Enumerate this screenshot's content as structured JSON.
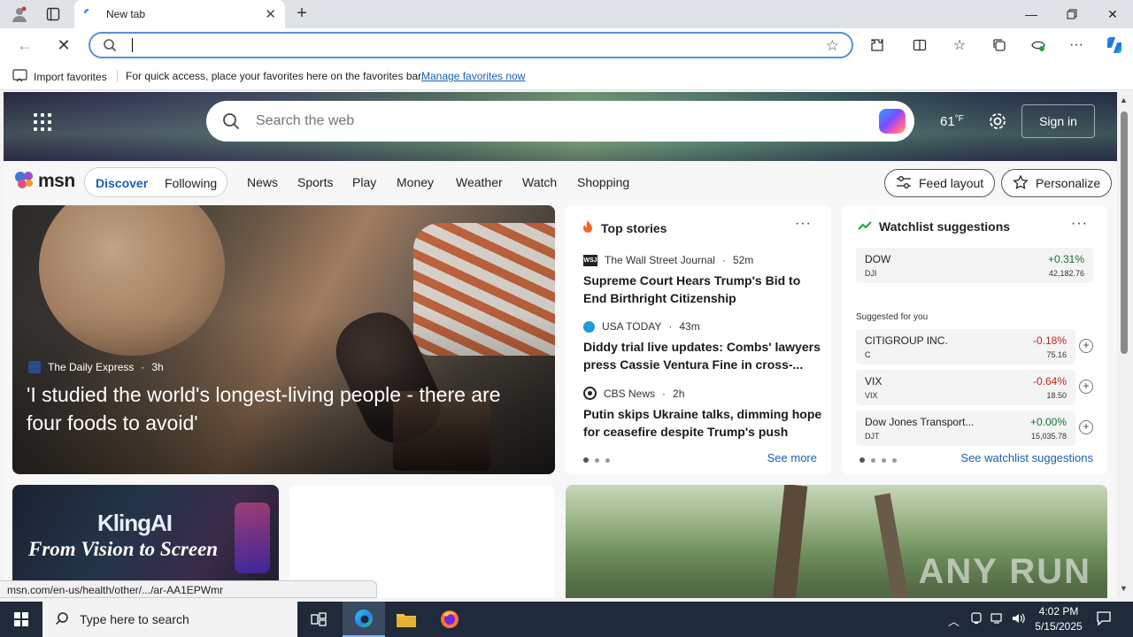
{
  "browser": {
    "tab_title": "New tab",
    "address_value": "",
    "favbar": {
      "import_label": "Import favorites",
      "message": "For quick access, place your favorites here on the favorites bar.",
      "manage_link": "Manage favorites now"
    }
  },
  "msn": {
    "search_placeholder": "Search the web",
    "weather_temp": "61",
    "weather_unit": "°F",
    "signin_label": "Sign in",
    "logo_text": "msn",
    "feed_tabs": [
      "Discover",
      "Following"
    ],
    "nav_links": [
      "News",
      "Sports",
      "Play",
      "Money",
      "Weather",
      "Watch",
      "Shopping"
    ],
    "feed_layout_label": "Feed layout",
    "personalize_label": "Personalize"
  },
  "hero": {
    "source": "The Daily Express",
    "age": "3h",
    "title": "'I studied the world's longest-living people - there are four foods to avoid'"
  },
  "top_stories": {
    "heading": "Top stories",
    "items": [
      {
        "source": "The Wall Street Journal",
        "age": "52m",
        "title": "Supreme Court Hears Trump's Bid to End Birthright Citizenship"
      },
      {
        "source": "USA TODAY",
        "age": "43m",
        "title": "Diddy trial live updates: Combs' lawyers press Cassie Ventura Fine in cross-..."
      },
      {
        "source": "CBS News",
        "age": "2h",
        "title": "Putin skips Ukraine talks, dimming hope for ceasefire despite Trump's push"
      }
    ],
    "see_more": "See more"
  },
  "watchlist": {
    "heading": "Watchlist suggestions",
    "pinned": {
      "name": "DOW",
      "symbol": "DJI",
      "change": "+0.31%",
      "price": "42,182.76",
      "direction": "up"
    },
    "suggested_label": "Suggested for you",
    "suggested": [
      {
        "name": "CITIGROUP INC.",
        "symbol": "C",
        "change": "-0.18%",
        "price": "75.16",
        "direction": "down"
      },
      {
        "name": "VIX",
        "symbol": "VIX",
        "change": "-0.64%",
        "price": "18.50",
        "direction": "down"
      },
      {
        "name": "Dow Jones Transport...",
        "symbol": "DJT",
        "change": "+0.00%",
        "price": "15,035.78",
        "direction": "up"
      }
    ],
    "see_link": "See watchlist suggestions"
  },
  "promo": {
    "brand": "KlingAI",
    "tagline": "From Vision to Screen"
  },
  "watermark": "ANY RUN",
  "status_url": "msn.com/en-us/health/other/.../ar-AA1EPWmr",
  "taskbar": {
    "search_placeholder": "Type here to search",
    "time": "4:02 PM",
    "date": "5/15/2025"
  },
  "colors": {
    "accent": "#1a5fb4",
    "positive": "#137333",
    "negative": "#c5221f"
  }
}
